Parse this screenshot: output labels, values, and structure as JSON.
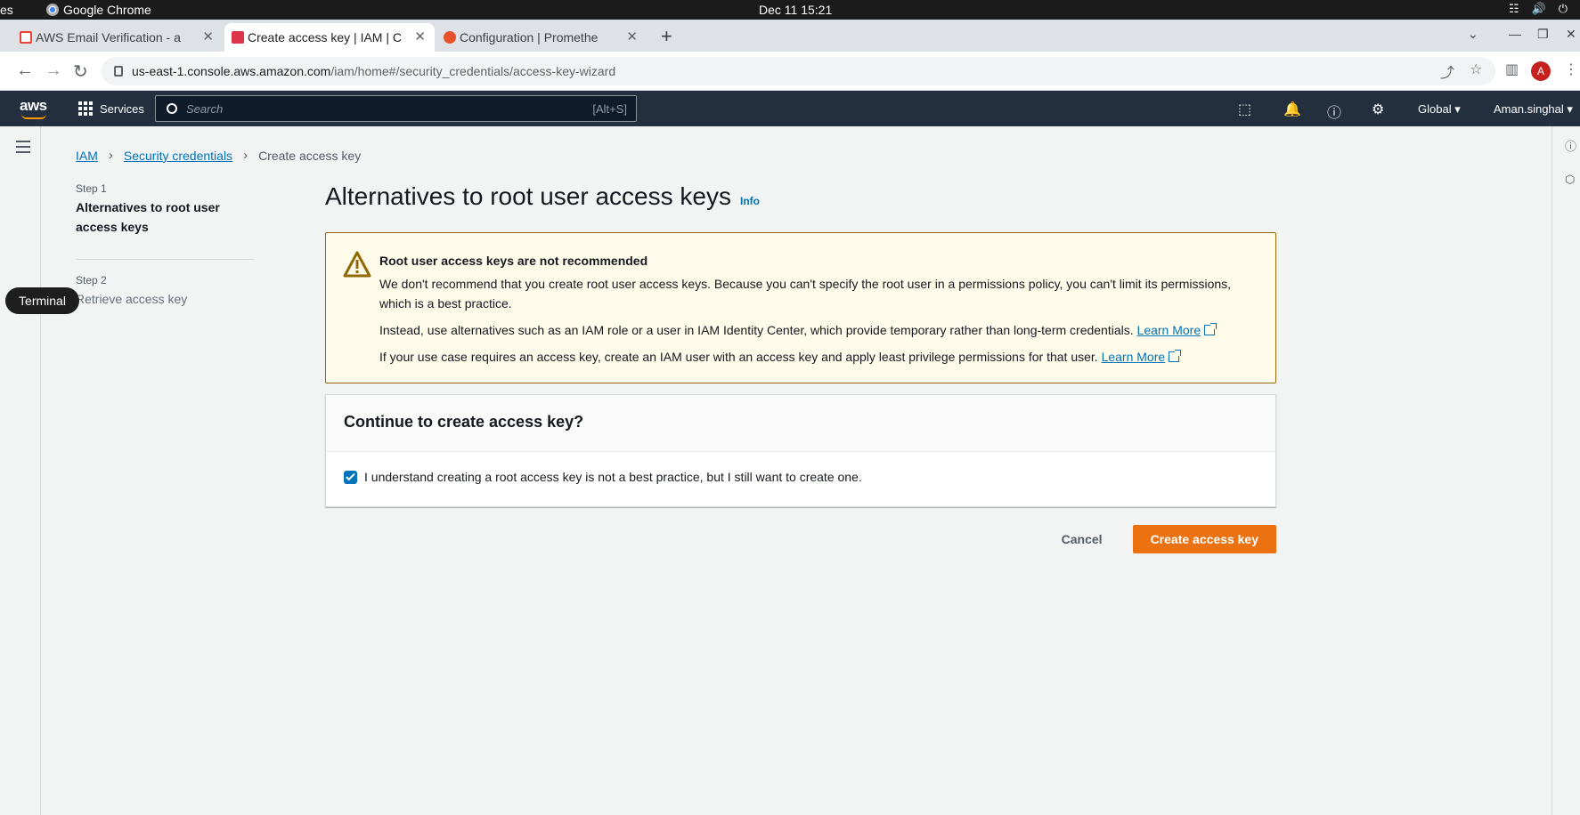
{
  "os": {
    "activities": "es",
    "app_name": "Google Chrome",
    "clock": "Dec 11  15:21"
  },
  "tabs": [
    {
      "title": "AWS Email Verification - a",
      "favicon": "gmail-icon",
      "active": false
    },
    {
      "title": "Create access key | IAM | C",
      "favicon": "aws-icon",
      "active": true
    },
    {
      "title": "Configuration | Promethe",
      "favicon": "prometheus-icon",
      "active": false
    }
  ],
  "address": {
    "host": "us-east-1.console.aws.amazon.com",
    "path": "/iam/home#/security_credentials/access-key-wizard"
  },
  "profile_initial": "A",
  "awsnav": {
    "logo": "aws",
    "services": "Services",
    "search_placeholder": "Search",
    "search_hint": "[Alt+S]",
    "region": "Global ▾",
    "user": "Aman.singhal ▾"
  },
  "tooltip": "Terminal",
  "breadcrumb": {
    "items": [
      "IAM",
      "Security credentials"
    ],
    "current": "Create access key"
  },
  "steps": [
    {
      "num": "Step 1",
      "title": "Alternatives to root user access keys"
    },
    {
      "num": "Step 2",
      "title": "Retrieve access key"
    }
  ],
  "main": {
    "title": "Alternatives to root user access keys",
    "info": "Info",
    "warning": {
      "heading": "Root user access keys are not recommended",
      "p1": "We don't recommend that you create root user access keys. Because you can't specify the root user in a permissions policy, you can't limit its permissions, which is a best practice.",
      "p2": "Instead, use alternatives such as an IAM role or a user in IAM Identity Center, which provide temporary rather than long-term credentials.",
      "p3": "If your use case requires an access key, create an IAM user with an access key and apply least privilege permissions for that user.",
      "learn_more": "Learn More"
    },
    "continue_heading": "Continue to create access key?",
    "checkbox_label": "I understand creating a root access key is not a best practice, but I still want to create one.",
    "cancel": "Cancel",
    "create": "Create access key"
  },
  "colors": {
    "aws_nav": "#232f3e",
    "primary_button": "#ec7211",
    "link": "#0073bb",
    "warning_bg": "#fffbea"
  }
}
